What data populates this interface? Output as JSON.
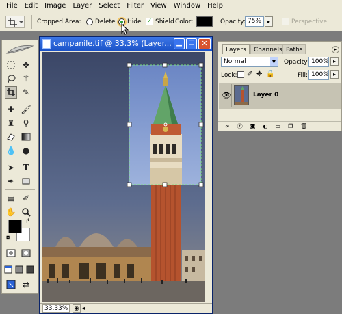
{
  "menu": [
    "File",
    "Edit",
    "Image",
    "Layer",
    "Select",
    "Filter",
    "View",
    "Window",
    "Help"
  ],
  "options": {
    "cropped_area_label": "Cropped Area:",
    "delete_label": "Delete",
    "hide_label": "Hide",
    "shield_label": "Shield",
    "color_label": "Color:",
    "opacity_label": "Opacity:",
    "opacity_value": "75%",
    "perspective_label": "Perspective",
    "shield_checked": true,
    "selected_mode": "Hide"
  },
  "document": {
    "title": "campanile.tif @ 33.3% (Layer...",
    "zoom": "33.33%"
  },
  "layers_panel": {
    "tabs": [
      "Layers",
      "Channels",
      "Paths"
    ],
    "blend_mode": "Normal",
    "opacity_label": "Opacity:",
    "opacity_value": "100%",
    "lock_label": "Lock:",
    "fill_label": "Fill:",
    "fill_value": "100%",
    "layer_name": "Layer 0"
  },
  "colors": {
    "chrome": "#ece9d8",
    "workspace": "#7c7c7c",
    "titlebar": "#2a62d6",
    "foreground": "#000000",
    "background": "#ffffff"
  }
}
